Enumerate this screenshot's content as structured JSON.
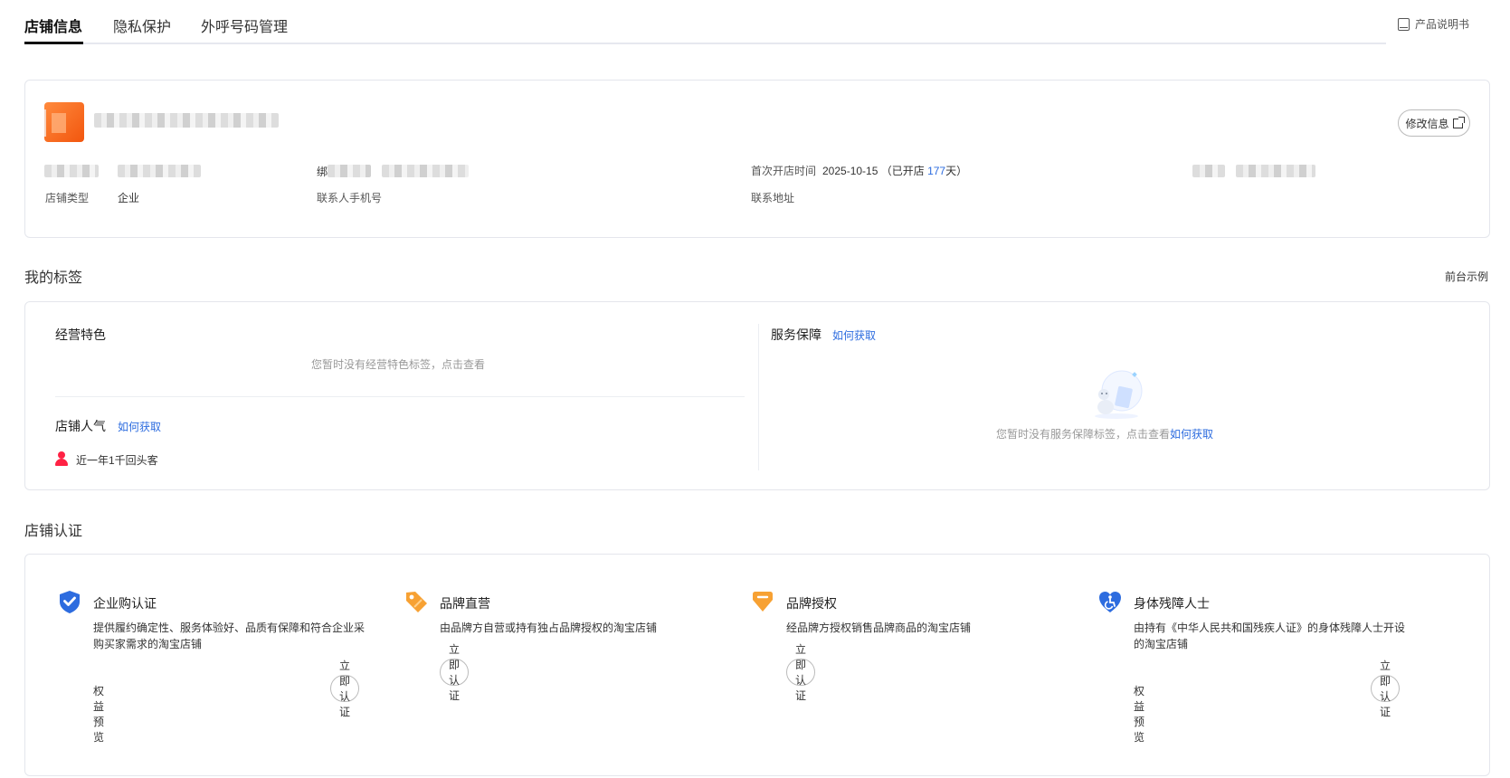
{
  "tabs": {
    "store_info": "店铺信息",
    "privacy": "隐私保护",
    "outbound": "外呼号码管理",
    "manual": "产品说明书"
  },
  "store": {
    "edit_label": "修改信息",
    "open_time_label": "首次开店时间",
    "open_date": "2025-10-15",
    "open_prefix": "（已开店 ",
    "open_days": "177",
    "open_suffix": "天）",
    "type_label": "店铺类型",
    "type_value": "企业",
    "phone_label": "联系人手机号",
    "address_label": "联系地址",
    "partial_char": "绑"
  },
  "my_tags": {
    "title": "我的标签",
    "front_example": "前台示例",
    "business_title": "经营特色",
    "business_empty": "您暂时没有经营特色标签，点击查看",
    "popularity_title": "店铺人气",
    "how_to_get": "如何获取",
    "repeat_customers": "近一年1千回头客",
    "service_title": "服务保障",
    "service_empty": "您暂时没有服务保障标签，点击查看"
  },
  "certification": {
    "title": "店铺认证",
    "items": [
      {
        "title": "企业购认证",
        "desc": "提供履约确定性、服务体验好、品质有保障和符合企业采购买家需求的淘宝店铺",
        "perk": "权益预览",
        "button": "立即认证",
        "icon": "shield-check-icon",
        "color": "#2d6cdf"
      },
      {
        "title": "品牌直营",
        "desc": "由品牌方自营或持有独占品牌授权的淘宝店铺",
        "button": "立即认证",
        "icon": "tag-icon",
        "color": "#f7a133"
      },
      {
        "title": "品牌授权",
        "desc": "经品牌方授权销售品牌商品的淘宝店铺",
        "button": "立即认证",
        "icon": "diamond-badge-icon",
        "color": "#f7a133"
      },
      {
        "title": "身体残障人士",
        "desc": "由持有《中华人民共和国残疾人证》的身体残障人士开设的淘宝店铺",
        "perk": "权益预览",
        "button": "立即认证",
        "icon": "accessibility-heart-icon",
        "color": "#2d6cdf"
      }
    ]
  }
}
